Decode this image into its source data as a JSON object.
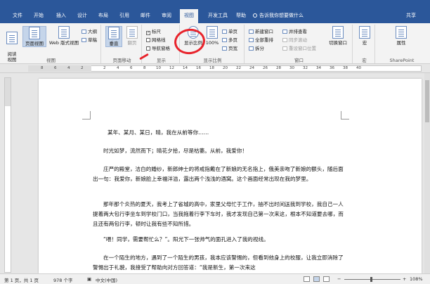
{
  "menubar": {
    "tabs": [
      "文件",
      "开始",
      "插入",
      "设计",
      "布局",
      "引用",
      "邮件",
      "审阅",
      "视图",
      "开发工具",
      "帮助"
    ],
    "active_tab": "视图",
    "tellme": "告诉我你想要做什么",
    "share": "共享"
  },
  "ribbon": {
    "views": {
      "label": "视图",
      "read_mode": "阅读\n视图",
      "print_layout": "页面视图",
      "web_layout": "Web 版式视图",
      "outline": "大纲",
      "draft": "草稿"
    },
    "page_move": {
      "label": "页面移动",
      "vertical": "垂直",
      "side_to_side": "翻页"
    },
    "show": {
      "label": "显示",
      "ruler": "标尺",
      "gridlines": "网格线",
      "nav_pane": "导航窗格"
    },
    "zoom": {
      "label": "显示比例",
      "zoom": "显示比例",
      "hundred": "100%",
      "one_page": "单页",
      "multi_page": "多页",
      "page_width": "页宽"
    },
    "window": {
      "label": "窗口",
      "new_window": "新建窗口",
      "arrange_all": "全部重排",
      "split": "拆分",
      "side_by_side": "并排查看",
      "sync_scroll": "同步滚动",
      "reset_pos": "重设窗口位置",
      "switch": "切换窗口"
    },
    "macros": {
      "label": "宏",
      "macros": "宏"
    },
    "sharepoint": {
      "label": "SharePoint",
      "properties": "属性"
    }
  },
  "ruler_numbers": [
    "8",
    "6",
    "4",
    "2",
    "2",
    "4",
    "6",
    "8",
    "10",
    "12",
    "14",
    "16",
    "18",
    "20",
    "22",
    "24",
    "26",
    "28",
    "30",
    "32",
    "34",
    "36",
    "38",
    "40"
  ],
  "document": {
    "paragraphs": [
      "某年、某月、某日，晴，我在从前等你……",
      "时光如梦，流然而下；晴花夕拾，尽是枯萎。从前，我爱你！",
      "庄严的殿堂，洁白的婚纱，新郎绅士的将戒指戴在了新娘的无名指上，俄美亲吻了新娘的额头，随后面出一句：我爱你，新娘脸上幸福洋溢，露出两个浅浅的酒窝。这个画面经常出现在我的梦里。",
      "那年那个炎热的夏天，我考上了省城的高中，家里父母忙于工作，抽不出时间送我到学校，我自己一人提着两大包行李坐车到学校门口，当我拖着行李下车时，我才发现自己第一次来这，根本不知道要去哪，而且还有两包行李，顿时让我有些不知所措。",
      "“喂！同学，需要帮忙么？”。阳光下一张帅气的面孔进入了我的视线。",
      "在一个陌生的地方，遇到了一个陌生的男孩，我本应该警惕的，但看到他身上的校服，让我立即消除了警惕出于礼貌，我接受了帮助向对方回答道：“我是新生，第一次来这"
    ]
  },
  "statusbar": {
    "page": "第 1 页，共 1 页",
    "words": "978 个字",
    "language": "中文(中国)",
    "zoom": "108%"
  }
}
